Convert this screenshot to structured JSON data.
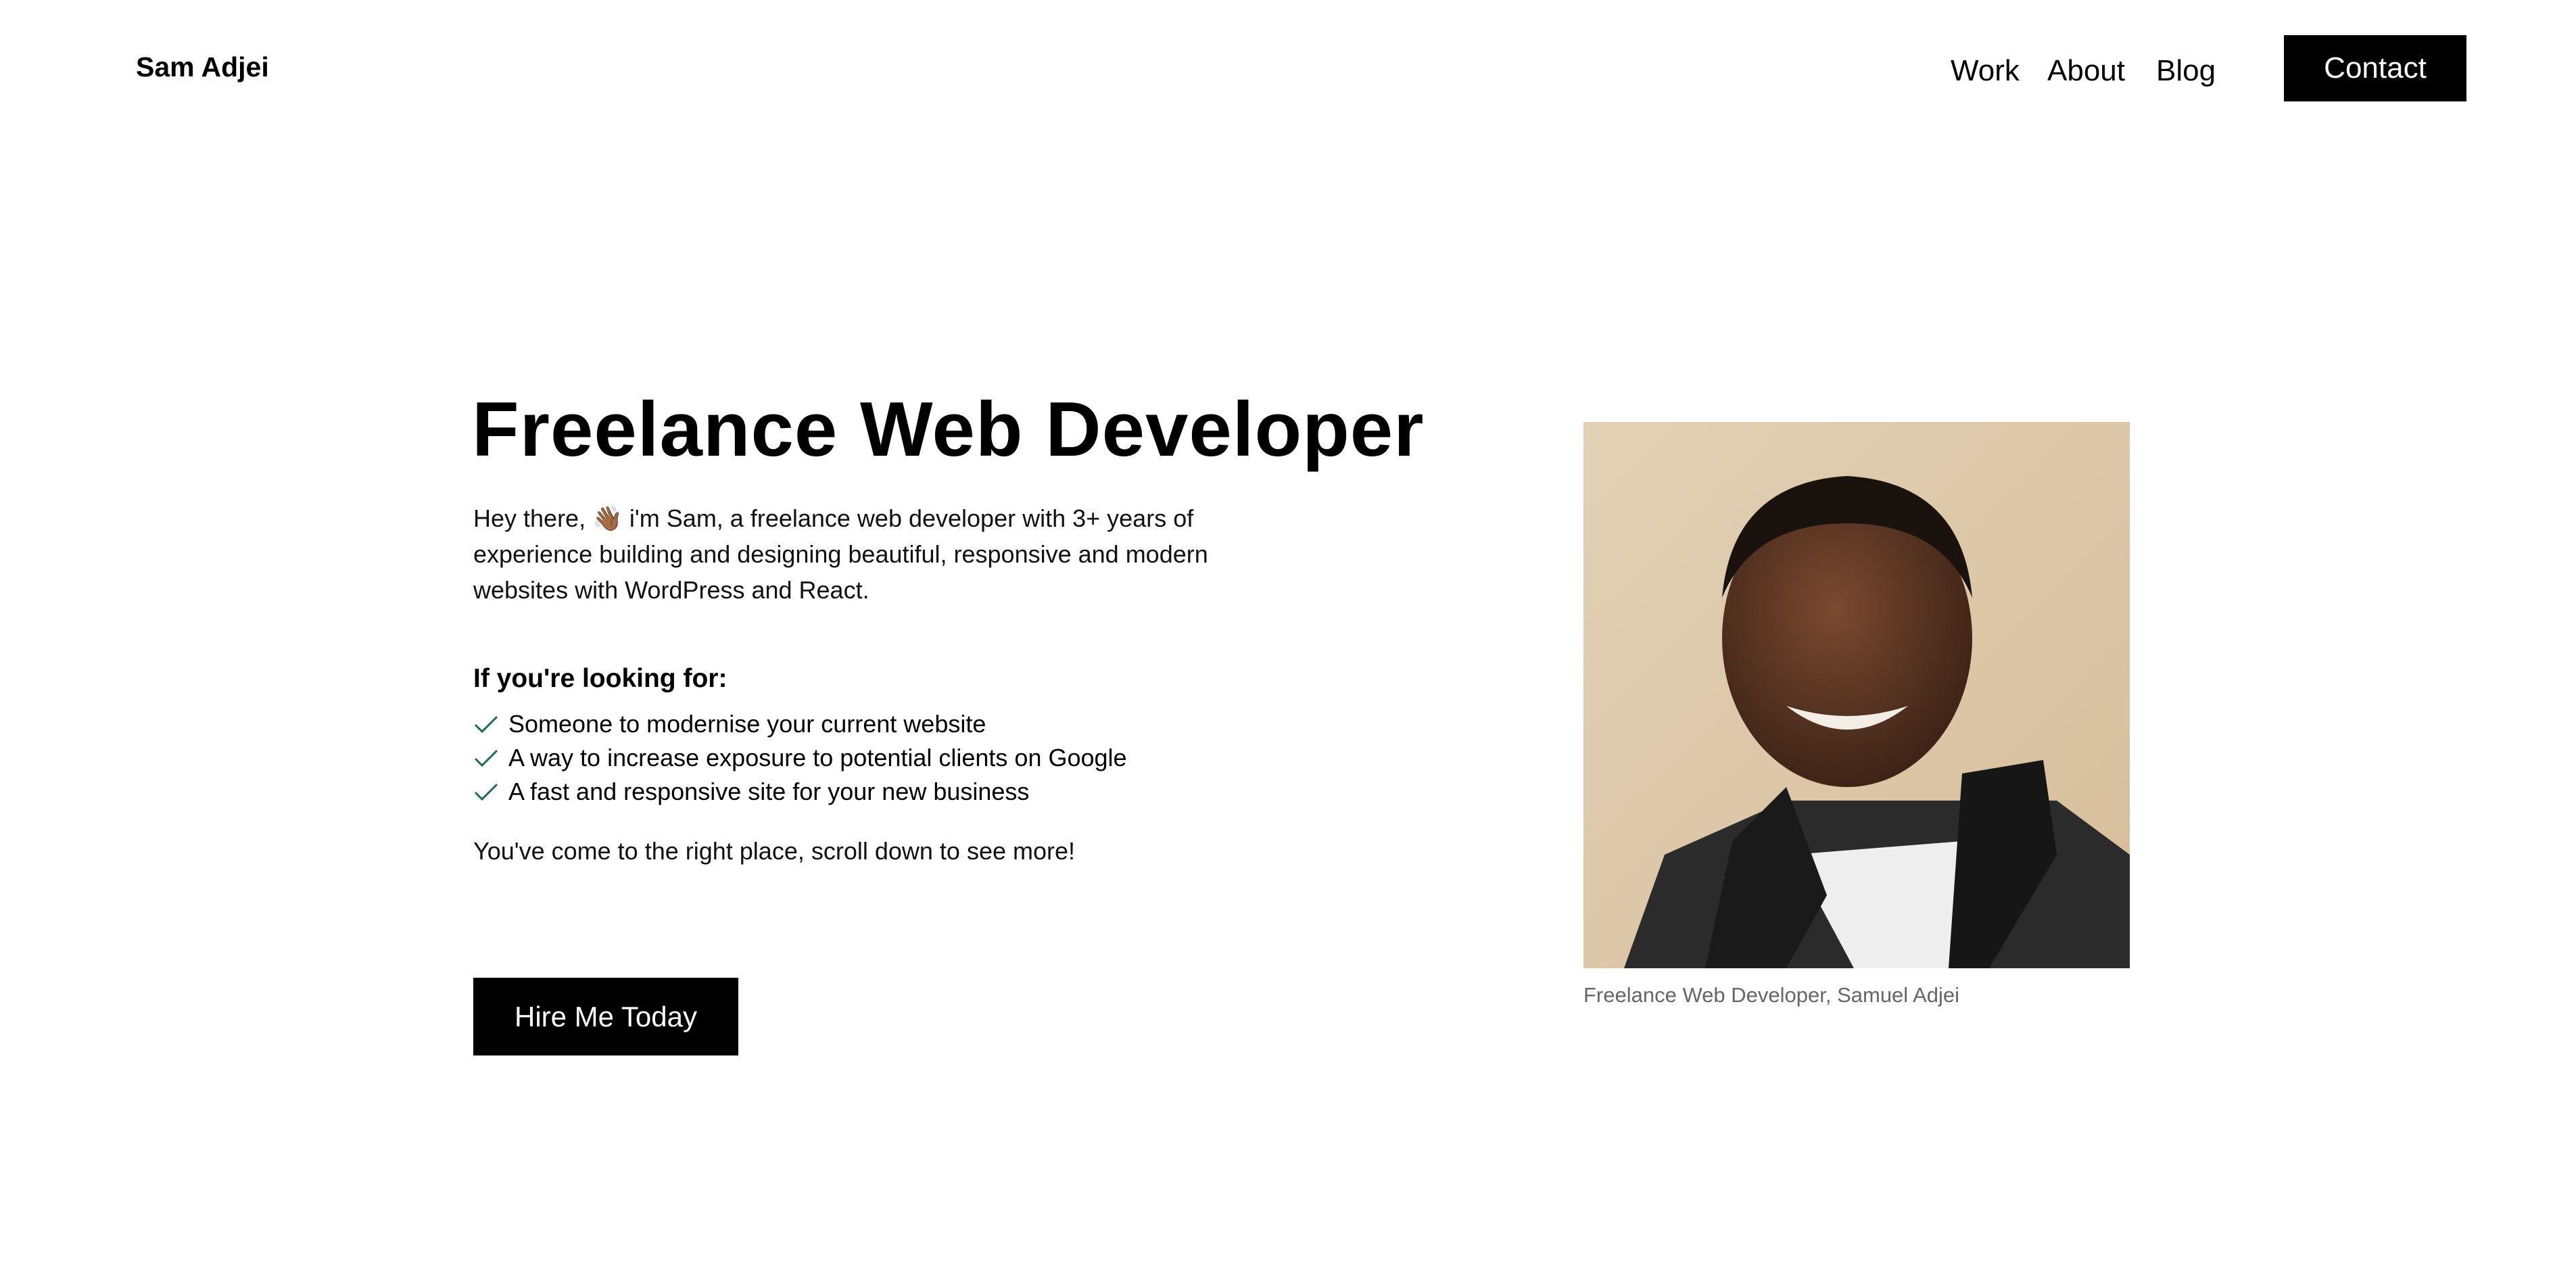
{
  "header": {
    "logo": "Sam Adjei",
    "nav": [
      "Work",
      "About",
      "Blog"
    ],
    "contact_label": "Contact"
  },
  "hero": {
    "title": "Freelance Web Developer",
    "intro_before": "Hey there, ",
    "wave_emoji": "👋🏾",
    "intro_after": " i'm Sam, a freelance web developer with 3+ years of experience building and designing beautiful, responsive and modern websites with WordPress and React.",
    "looking_heading": "If you're looking for:",
    "looking_items": [
      "Someone to modernise your current website",
      "A way to increase exposure to potential clients on Google",
      "A fast and responsive site for your new business"
    ],
    "closing": "You've come to the right place, scroll down to see more!",
    "cta_label": "Hire Me Today",
    "photo_caption": "Freelance Web Developer, Samuel Adjei"
  },
  "colors": {
    "check": "#1a6b5a",
    "caption": "#666666"
  }
}
